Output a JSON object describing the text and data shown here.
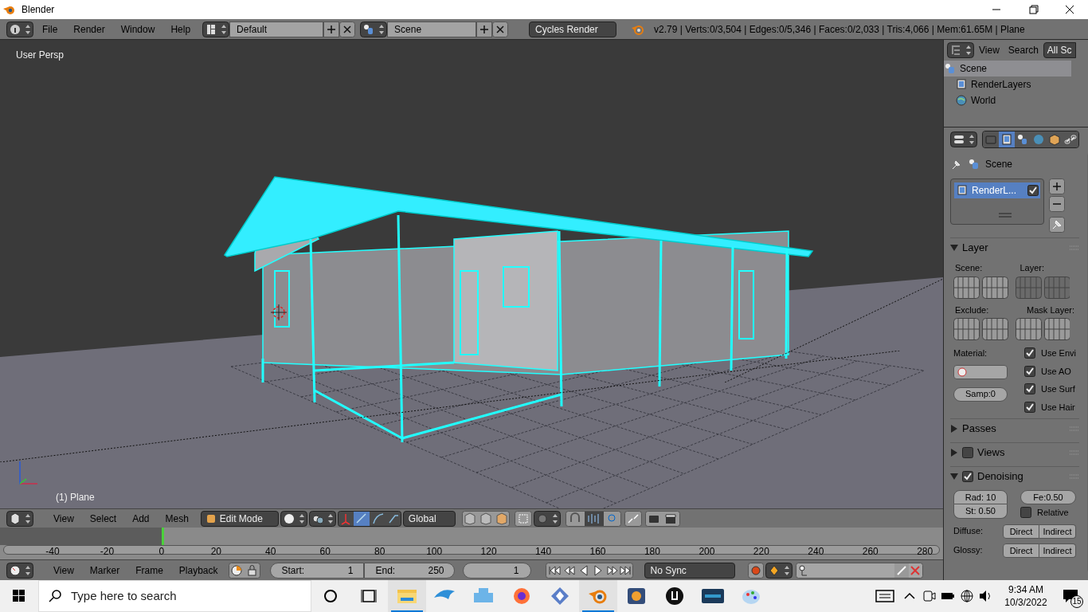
{
  "window": {
    "title": "Blender"
  },
  "info_header": {
    "menus": [
      "File",
      "Render",
      "Window",
      "Help"
    ],
    "screen_layout": "Default",
    "scene": "Scene",
    "render_engine": "Cycles Render",
    "stats": "v2.79 | Verts:0/3,504 | Edges:0/5,346 | Faces:0/2,033 | Tris:4,066 | Mem:61.65M | Plane"
  },
  "viewport": {
    "view_label": "User Persp",
    "object_label": "(1) Plane"
  },
  "outliner": {
    "menus": [
      "View",
      "Search"
    ],
    "filter": "All Sc",
    "items": [
      {
        "label": "Scene",
        "kind": "scene",
        "selected": true
      },
      {
        "label": "RenderLayers",
        "kind": "renderlayers",
        "selected": false
      },
      {
        "label": "World",
        "kind": "world",
        "selected": false
      }
    ]
  },
  "properties": {
    "tabs": [
      {
        "kind": "render",
        "selected": false
      },
      {
        "kind": "renderlayers",
        "selected": true
      },
      {
        "kind": "scene",
        "selected": false
      },
      {
        "kind": "world",
        "selected": false
      },
      {
        "kind": "object",
        "selected": false
      },
      {
        "kind": "constraints",
        "selected": false
      }
    ],
    "context": "Scene",
    "layers": [
      {
        "label": "RenderL...",
        "enabled": true,
        "selected": true
      }
    ],
    "layer_panel": {
      "title": "Layer",
      "expanded": true,
      "scene_label": "Scene:",
      "layer_label": "Layer:",
      "exclude_label": "Exclude:",
      "mask_label": "Mask Layer:",
      "material_label": "Material:",
      "samples": "Samp:0",
      "options": [
        {
          "label": "Use Envi",
          "checked": true
        },
        {
          "label": "Use AO",
          "checked": true
        },
        {
          "label": "Use Surf",
          "checked": true
        },
        {
          "label": "Use Hair",
          "checked": true
        }
      ]
    },
    "passes_panel": {
      "title": "Passes",
      "expanded": false
    },
    "views_panel": {
      "title": "Views",
      "expanded": false,
      "checked": false
    },
    "denoising_panel": {
      "title": "Denoising",
      "expanded": true,
      "checked": true,
      "radius": "Rad: 10",
      "strength": "St: 0.50",
      "feature": "Fe:0.50",
      "relative": {
        "label": "Relative",
        "checked": false
      },
      "rows": [
        {
          "label": "Diffuse:",
          "direct": "Direct",
          "indirect": "Indirect"
        },
        {
          "label": "Glossy:",
          "direct": "Direct",
          "indirect": "Indirect"
        }
      ]
    }
  },
  "view3d_header": {
    "menus": [
      "View",
      "Select",
      "Add",
      "Mesh"
    ],
    "mode": "Edit Mode",
    "orientation": "Global"
  },
  "timeline": {
    "ticks": [
      "-40",
      "-20",
      "0",
      "20",
      "40",
      "60",
      "80",
      "100",
      "120",
      "140",
      "160",
      "180",
      "200",
      "220",
      "240",
      "260",
      "280"
    ]
  },
  "timeline_header": {
    "menus": [
      "View",
      "Marker",
      "Frame",
      "Playback"
    ],
    "start_label": "Start:",
    "start": "1",
    "end_label": "End:",
    "end": "250",
    "current": "1",
    "sync": "No Sync"
  },
  "taskbar": {
    "search_placeholder": "Type here to search",
    "apps": [
      {
        "kind": "folder",
        "running": true
      },
      {
        "kind": "dolphin",
        "running": false
      },
      {
        "kind": "gamepad",
        "running": false
      },
      {
        "kind": "firefox",
        "running": false
      },
      {
        "kind": "diamond",
        "running": false
      },
      {
        "kind": "blender",
        "running": true
      },
      {
        "kind": "media",
        "running": false
      },
      {
        "kind": "unreal",
        "running": false
      },
      {
        "kind": "badge",
        "running": false
      },
      {
        "kind": "paint",
        "running": false
      }
    ],
    "time": "9:34 AM",
    "date": "10/3/2022",
    "notifications": "15"
  }
}
